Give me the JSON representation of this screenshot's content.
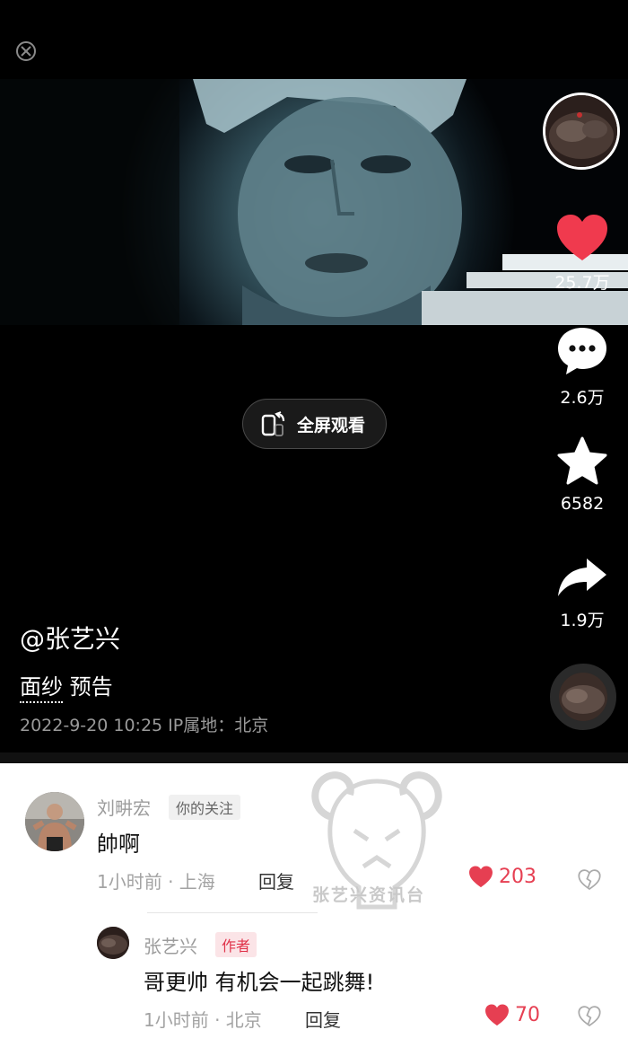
{
  "video": {
    "fullscreen_label": "全屏观看",
    "handle": "@张艺兴",
    "caption_tag": "面纱",
    "caption_rest": " 预告",
    "meta": "2022-9-20 10:25  IP属地：北京"
  },
  "rail": {
    "likes": "25.7万",
    "comments": "2.6万",
    "favorites": "6582",
    "shares": "1.9万",
    "like_color": "#f03a4e"
  },
  "watermark": {
    "text": "张艺兴资讯台"
  },
  "comments": [
    {
      "name": "刘畊宏",
      "badge": "你的关注",
      "text": "帥啊",
      "time_location": "1小时前 · 上海",
      "reply_label": "回复",
      "likes": "203"
    }
  ],
  "reply": {
    "name": "张艺兴",
    "badge": "作者",
    "text": "哥更帅 有机会一起跳舞!",
    "time_location": "1小时前 · 北京",
    "reply_label": "回复",
    "likes": "70"
  }
}
